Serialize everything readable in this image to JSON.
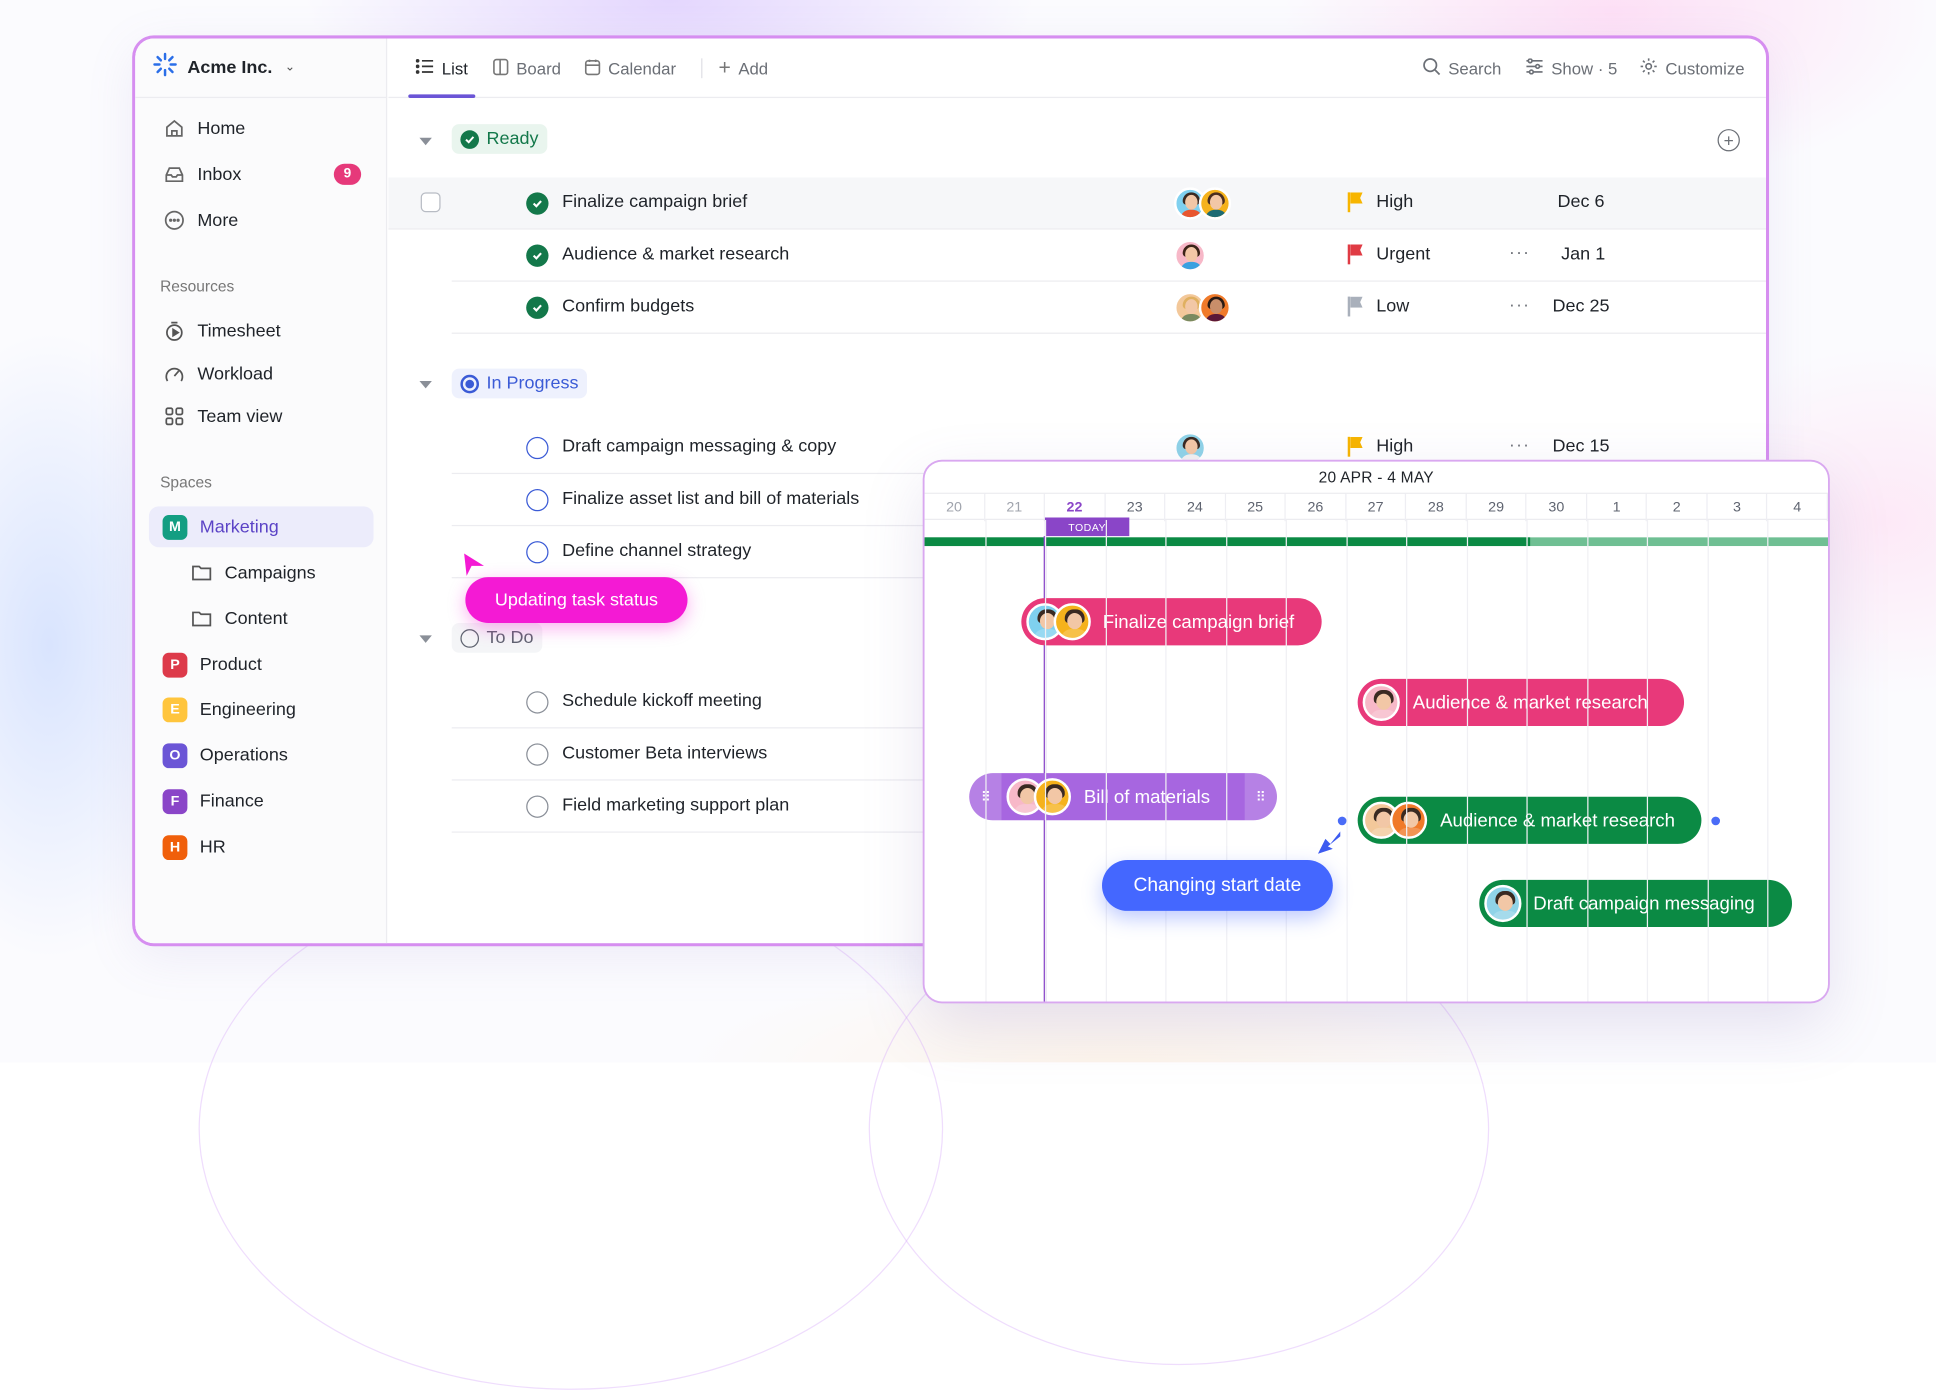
{
  "workspace": {
    "name": "Acme Inc.",
    "logo_icon": "spark-logo-icon",
    "dropdown_icon": "chevron-down-icon"
  },
  "sidebar": {
    "nav": [
      {
        "label": "Home",
        "icon": "home-icon"
      },
      {
        "label": "Inbox",
        "icon": "inbox-icon",
        "badge": "9"
      },
      {
        "label": "More",
        "icon": "more-circle-icon"
      }
    ],
    "resources_heading": "Resources",
    "resources": [
      {
        "label": "Timesheet",
        "icon": "timer-icon"
      },
      {
        "label": "Workload",
        "icon": "gauge-icon"
      },
      {
        "label": "Team view",
        "icon": "grid-icon"
      }
    ],
    "spaces_heading": "Spaces",
    "spaces": [
      {
        "label": "Marketing",
        "letter": "M",
        "color": "#139e82",
        "active": true
      },
      {
        "label": "Campaigns",
        "folder": true
      },
      {
        "label": "Content",
        "folder": true
      },
      {
        "label": "Product",
        "letter": "P",
        "color": "#dd3a4a"
      },
      {
        "label": "Engineering",
        "letter": "E",
        "color": "#ffc53d"
      },
      {
        "label": "Operations",
        "letter": "O",
        "color": "#6b55d6"
      },
      {
        "label": "Finance",
        "letter": "F",
        "color": "#8a45c8"
      },
      {
        "label": "HR",
        "letter": "H",
        "color": "#f05f0b"
      }
    ]
  },
  "tabs": [
    {
      "label": "List",
      "icon": "list-icon",
      "active": true
    },
    {
      "label": "Board",
      "icon": "board-icon"
    },
    {
      "label": "Calendar",
      "icon": "calendar-icon"
    },
    {
      "label": "Add",
      "icon": "plus-icon"
    }
  ],
  "toolbar": {
    "search": "Search",
    "show": "Show · 5",
    "customize": "Customize"
  },
  "groups": [
    {
      "label": "Ready",
      "status": "done",
      "color": "#13784a",
      "bg": "#e9f5ee",
      "tasks": [
        {
          "name": "Finalize campaign brief",
          "priority": "High",
          "priority_color": "#f7b500",
          "date": "Dec 6",
          "avatars": 2
        },
        {
          "name": "Audience & market research",
          "priority": "Urgent",
          "priority_color": "#e03b44",
          "date": "Jan 1",
          "avatars": 1
        },
        {
          "name": "Confirm budgets",
          "priority": "Low",
          "priority_color": "#a9b0bb",
          "date": "Dec 25",
          "avatars": 2
        }
      ]
    },
    {
      "label": "In Progress",
      "status": "progress",
      "color": "#3b5bd6",
      "bg": "#eef1fd",
      "tasks": [
        {
          "name": "Draft campaign messaging & copy",
          "priority": "High",
          "priority_color": "#f7b500",
          "date": "Dec 15",
          "avatars": 1
        },
        {
          "name": "Finalize asset list and bill of materials"
        },
        {
          "name": "Define channel strategy"
        }
      ]
    },
    {
      "label": "To Do",
      "status": "todo",
      "color": "#5f6470",
      "bg": "#f4f5f7",
      "tasks": [
        {
          "name": "Schedule kickoff meeting"
        },
        {
          "name": "Customer Beta interviews"
        },
        {
          "name": "Field marketing support plan"
        }
      ]
    }
  ],
  "tooltip_status": "Updating task status",
  "gantt": {
    "range_title": "20 APR - 4 MAY",
    "days": [
      "20",
      "21",
      "22",
      "23",
      "24",
      "25",
      "26",
      "27",
      "28",
      "29",
      "30",
      "1",
      "2",
      "3",
      "4"
    ],
    "today_index": 2,
    "today_label": "TODAY",
    "progress_fraction": 0.67,
    "bars": [
      {
        "label": "Finalize campaign brief",
        "color": "#e8397a",
        "start": 1.6,
        "end": 6.6,
        "lane": 0,
        "avatars": 2
      },
      {
        "label": "Audience & market research",
        "color": "#e8397a",
        "start": 7.2,
        "end": 12.6,
        "lane": 1,
        "avatars": 1
      },
      {
        "label": "Bill of materials",
        "color": "#a766e0",
        "start": 1.0,
        "end": 6.1,
        "lane": 2,
        "avatars": 2,
        "handles": true
      },
      {
        "label": "Audience & market research",
        "color": "#0b8a44",
        "start": 7.2,
        "end": 12.9,
        "lane": 3,
        "avatars": 2,
        "connectors": true
      },
      {
        "label": "Draft campaign messaging",
        "color": "#0b8a44",
        "start": 9.2,
        "end": 14.4,
        "lane": 4,
        "avatars": 1
      }
    ],
    "drag_chip": "Changing start date"
  }
}
